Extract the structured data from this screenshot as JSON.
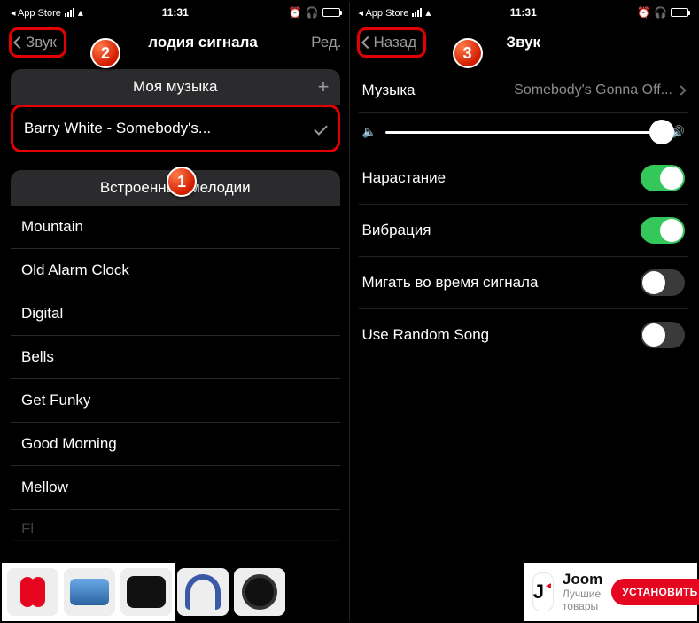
{
  "statusbar": {
    "app_store": "◂ App Store",
    "time": "11:31"
  },
  "left": {
    "nav": {
      "back": "Звук",
      "title_suffix": "лодия сигнала",
      "right": "Ред."
    },
    "my_music_header": "Моя музыка",
    "selected_track": "Barry White -  Somebody's...",
    "builtin_header": "Встроенные мелодии",
    "builtin": [
      "Mountain",
      "Old Alarm Clock",
      "Digital",
      "Bells",
      "Get Funky",
      "Good Morning",
      "Mellow"
    ],
    "builtin_faded": "Fl"
  },
  "right": {
    "nav": {
      "back": "Назад",
      "title": "Звук"
    },
    "music_label": "Музыка",
    "music_value": "Somebody's Gonna Off...",
    "settings": {
      "rise": {
        "label": "Нарастание",
        "on": true
      },
      "vibration": {
        "label": "Вибрация",
        "on": true
      },
      "blink": {
        "label": "Мигать во время сигнала",
        "on": false
      },
      "random": {
        "label": "Use Random Song",
        "on": false
      }
    }
  },
  "ad": {
    "brand": "Joom",
    "tagline": "Лучшие товары",
    "install": "УСТАНОВИТЬ"
  },
  "badges": {
    "b1": "1",
    "b2": "2",
    "b3": "3"
  }
}
